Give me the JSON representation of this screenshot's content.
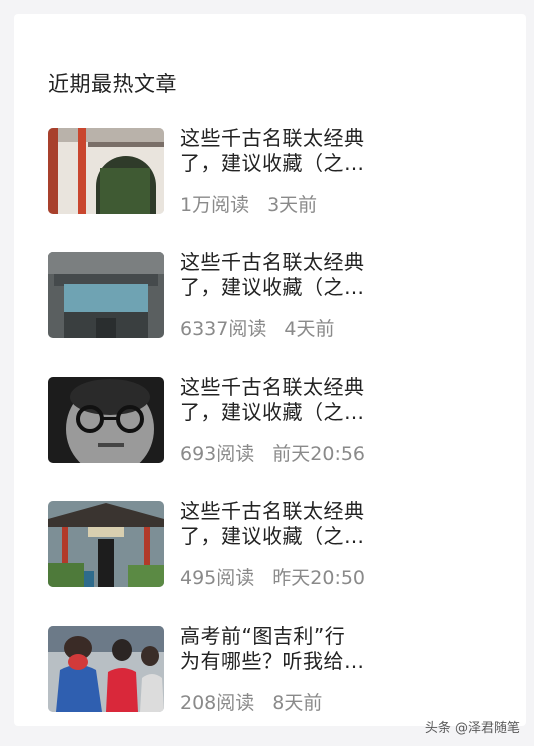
{
  "section": {
    "title": "近期最热文章"
  },
  "articles": [
    {
      "title_line1": "这些千古名联太经典",
      "title_line2": "了，建议收藏（之…",
      "reads": "1万阅读",
      "time": "3天前"
    },
    {
      "title_line1": "这些千古名联太经典",
      "title_line2": "了，建议收藏（之…",
      "reads": "6337阅读",
      "time": "4天前"
    },
    {
      "title_line1": "这些千古名联太经典",
      "title_line2": "了，建议收藏（之…",
      "reads": "693阅读",
      "time": "前天20:56"
    },
    {
      "title_line1": "这些千古名联太经典",
      "title_line2": "了，建议收藏（之…",
      "reads": "495阅读",
      "time": "昨天20:50"
    },
    {
      "title_line1": "高考前“图吉利”行",
      "title_line2": "为有哪些？听我给…",
      "reads": "208阅读",
      "time": "8天前"
    }
  ],
  "watermark": "头条 @泽君随笔"
}
